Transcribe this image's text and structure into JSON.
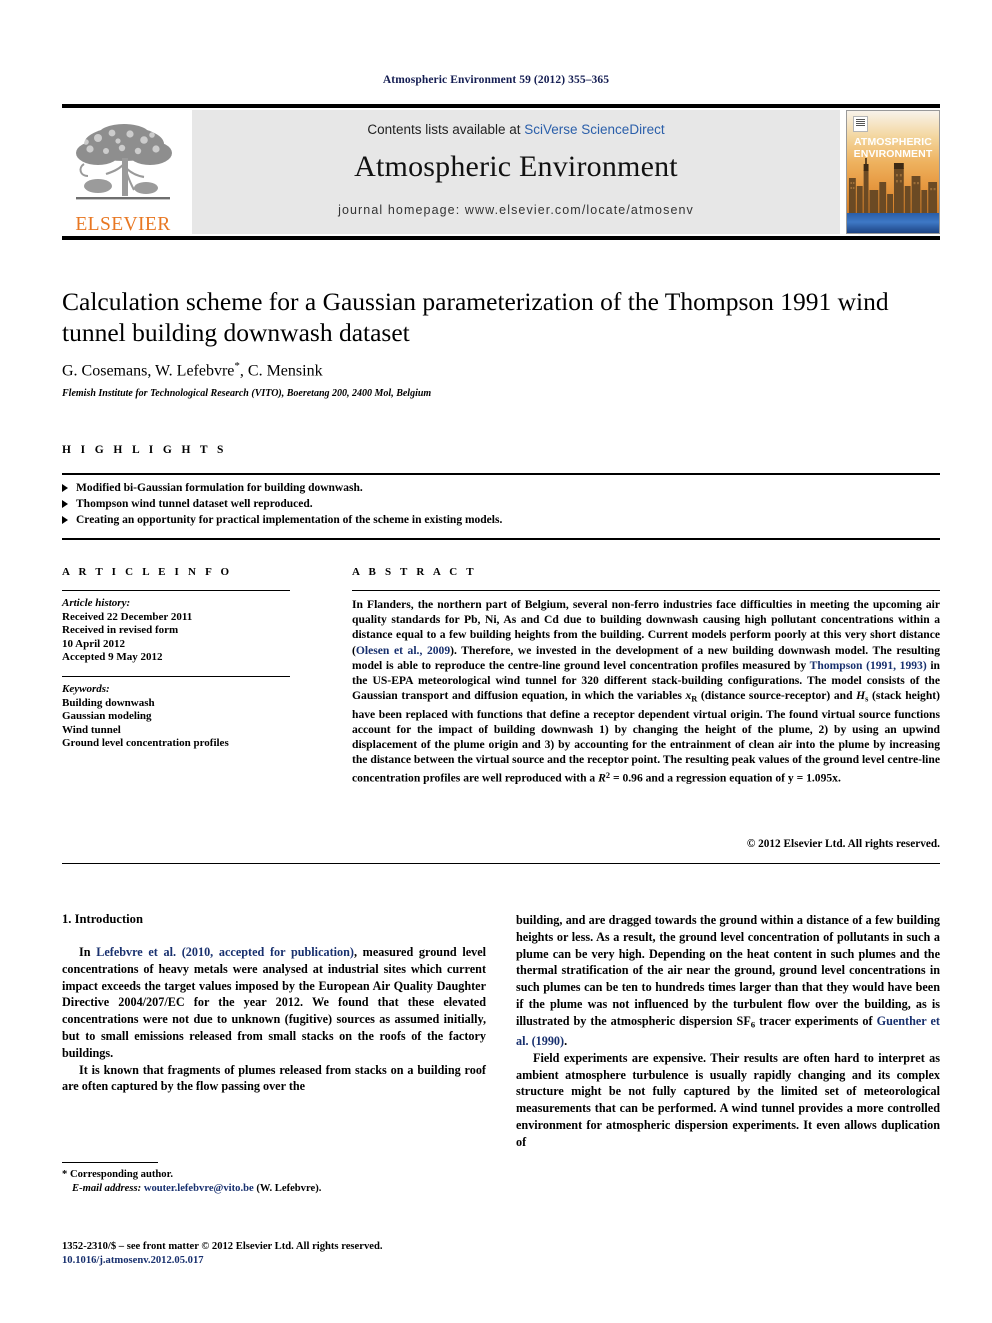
{
  "running_head": "Atmospheric Environment 59 (2012) 355–365",
  "masthead": {
    "publisher_name": "ELSEVIER",
    "contents_prefix": "Contents lists available at ",
    "contents_link": "SciVerse ScienceDirect",
    "journal_title": "Atmospheric Environment",
    "homepage": "journal homepage: www.elsevier.com/locate/atmosenv",
    "cover_title_line1": "ATMOSPHERIC",
    "cover_title_line2": "ENVIRONMENT"
  },
  "article": {
    "title": "Calculation scheme for a Gaussian parameterization of the Thompson 1991 wind tunnel building downwash dataset",
    "authors": "G. Cosemans, W. Lefebvre",
    "authors_suffix": ", C. Mensink",
    "corresponding_marker": "*",
    "affiliation": "Flemish Institute for Technological Research (VITO), Boeretang 200, 2400 Mol, Belgium"
  },
  "highlights": {
    "heading": "H I G H L I G H T S",
    "items": [
      "Modified bi-Gaussian formulation for building downwash.",
      "Thompson wind tunnel dataset well reproduced.",
      "Creating an opportunity for practical implementation of the scheme in existing models."
    ]
  },
  "article_info": {
    "heading": "A R T I C L E   I N F O",
    "history_label": "Article history:",
    "history": [
      "Received 22 December 2011",
      "Received in revised form",
      "10 April 2012",
      "Accepted 9 May 2012"
    ],
    "keywords_label": "Keywords:",
    "keywords": [
      "Building downwash",
      "Gaussian modeling",
      "Wind tunnel",
      "Ground level concentration profiles"
    ]
  },
  "abstract": {
    "heading": "A B S T R A C T",
    "p1_a": "In Flanders, the northern part of Belgium, several non-ferro industries face difficulties in meeting the upcoming air quality standards for Pb, Ni, As and Cd due to building downwash causing high pollutant concentrations within a distance equal to a few building heights from the building. Current models perform poorly at this very short distance (",
    "ref1": "Olesen et al., 2009",
    "p1_b": "). Therefore, we invested in the development of a new building downwash model. The resulting model is able to reproduce the centre-line ground level concentration profiles measured by ",
    "ref2": "Thompson (1991, 1993)",
    "p1_c": " in the US-EPA meteorological wind tunnel for 320 different stack-building configurations. The model consists of the Gaussian transport and diffusion equation, in which the variables ",
    "var1_base": "x",
    "var1_sub": "R",
    "p1_d": " (distance source-receptor) and ",
    "var2_base": "H",
    "var2_sub": "s",
    "p1_e": " (stack height) have been replaced with functions that define a receptor dependent virtual origin. The found virtual source functions account for the impact of building downwash 1) by changing the height of the plume, 2) by using an upwind displacement of the plume origin and 3) by accounting for the entrainment of clean air into the plume by increasing the distance between the virtual source and the receptor point. The resulting peak values of the ground level centre-line concentration profiles are well reproduced with a ",
    "var3_base": "R",
    "var3_sup": "2",
    "p1_f": " = 0.96 and a regression equation of y = 1.095x.",
    "copyright": "© 2012 Elsevier Ltd. All rights reserved."
  },
  "body": {
    "section_heading": "1.  Introduction",
    "left_p1_a": "In ",
    "left_ref1": "Lefebvre et al. (2010, accepted for publication)",
    "left_p1_b": ", measured ground level concentrations of heavy metals were analysed at industrial sites which current impact exceeds the target values imposed by the European Air Quality Daughter Directive 2004/207/EC for the year 2012. We found that these elevated concentrations were not due to unknown (fugitive) sources as assumed initially, but to small emissions released from small stacks on the roofs of the factory buildings.",
    "left_p2": "It is known that fragments of plumes released from stacks on a building roof are often captured by the flow passing over the",
    "right_p1_a": "building, and are dragged towards the ground within a distance of a few building heights or less. As a result, the ground level concentration of pollutants in such a plume can be very high. Depending on the heat content in such plumes and the thermal stratification of the air near the ground, ground level concentrations in such plumes can be ten to hundreds times larger than that they would have been if the plume was not influenced by the turbulent flow over the building, as is illustrated by the atmospheric dispersion SF",
    "right_sf6_sub": "6",
    "right_p1_b": " tracer experiments of ",
    "right_ref1": "Guenther et al. (1990)",
    "right_p1_c": ".",
    "right_p2": "Field experiments are expensive. Their results are often hard to interpret as ambient atmosphere turbulence is usually rapidly changing and its complex structure might be not fully captured by the limited set of meteorological measurements that can be performed. A wind tunnel provides a more controlled environment for atmospheric dispersion experiments. It even allows duplication of"
  },
  "footnotes": {
    "corresponding": "* Corresponding author.",
    "email_label": "E-mail address:",
    "email": "wouter.lefebvre@vito.be",
    "email_owner": " (W. Lefebvre).",
    "imprint": "1352-2310/$ – see front matter © 2012 Elsevier Ltd. All rights reserved.",
    "doi": "10.1016/j.atmosenv.2012.05.017"
  },
  "colors": {
    "link_blue": "#2b5faa",
    "ref_navy": "#18306e",
    "elsevier_orange": "#E87722",
    "banner_gray": "#e7e7e7"
  }
}
